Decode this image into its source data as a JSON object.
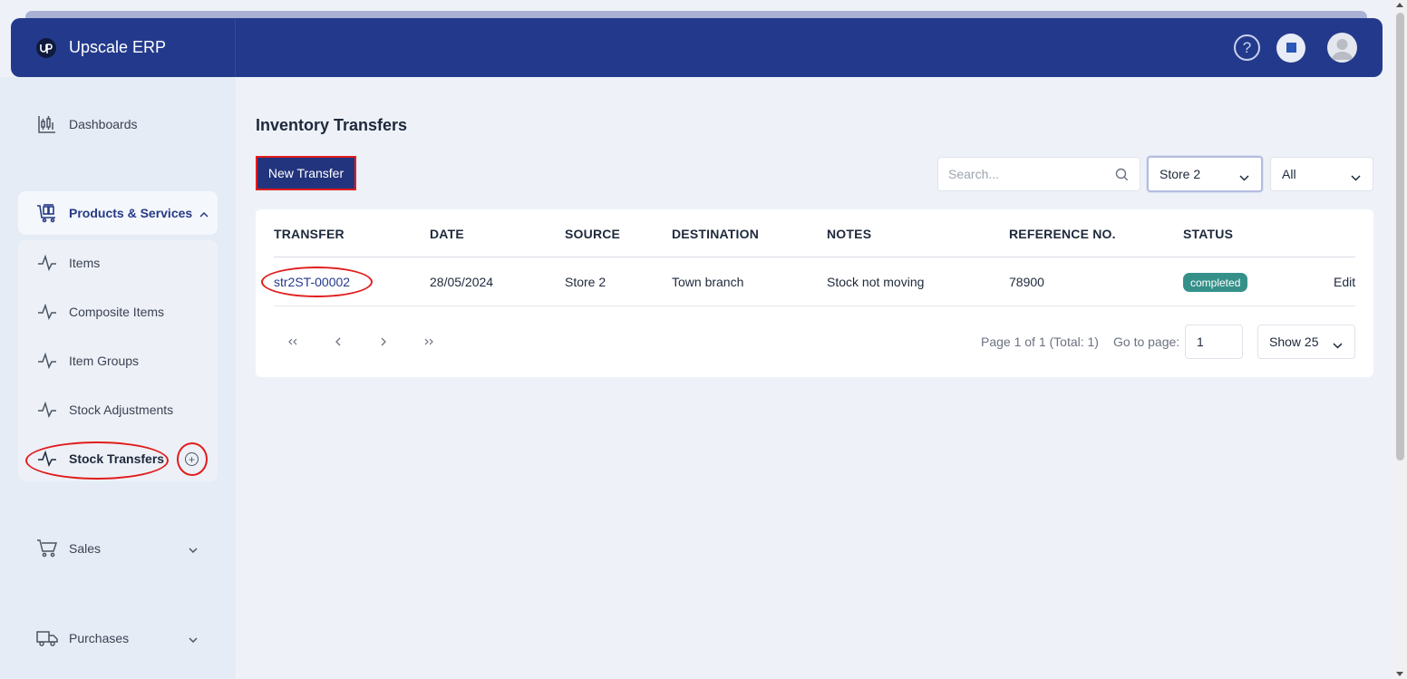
{
  "app": {
    "name": "Upscale ERP",
    "logo_text": "UP"
  },
  "header": {
    "help_icon": "question-circle-icon",
    "apps_icon": "square-app-icon",
    "avatar_icon": "user-avatar-icon"
  },
  "sidebar": {
    "dashboards": "Dashboards",
    "products_services": "Products & Services",
    "items": [
      "Items",
      "Composite Items",
      "Item Groups",
      "Stock Adjustments",
      "Stock Transfers"
    ],
    "sales": "Sales",
    "purchases": "Purchases"
  },
  "page": {
    "title": "Inventory Transfers",
    "new_button": "New Transfer",
    "search_placeholder": "Search...",
    "store_select": "Store 2",
    "status_select": "All"
  },
  "table": {
    "headers": [
      "TRANSFER",
      "DATE",
      "SOURCE",
      "DESTINATION",
      "NOTES",
      "REFERENCE NO.",
      "STATUS"
    ],
    "rows": [
      {
        "transfer": "str2ST-00002",
        "date": "28/05/2024",
        "source": "Store 2",
        "destination": "Town branch",
        "notes": "Stock not moving",
        "reference": "78900",
        "status": "completed",
        "action": "Edit"
      }
    ]
  },
  "pagination": {
    "first": "«",
    "prev": "‹",
    "next": "›",
    "last": "»",
    "info": "Page 1 of 1 (Total: 1)",
    "goto_label": "Go to page:",
    "goto_value": "1",
    "page_size": "Show 25"
  },
  "colors": {
    "header": "#233a8c",
    "accent": "#22347d",
    "status_completed": "#35908a",
    "annotation": "#e11d1d"
  }
}
